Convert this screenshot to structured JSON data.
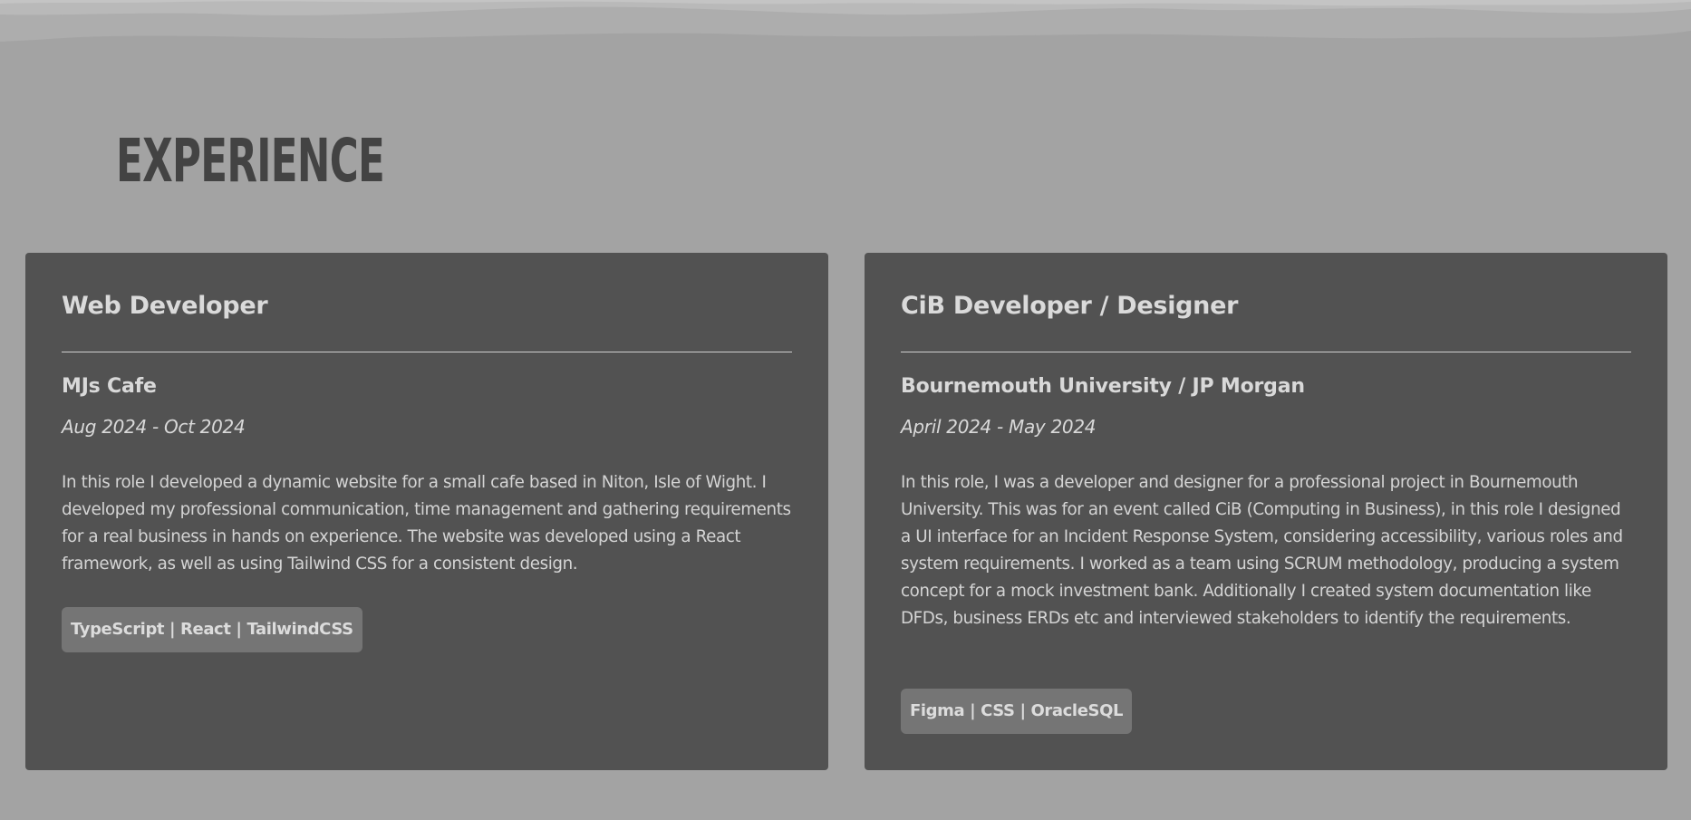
{
  "section": {
    "title": "EXPERIENCE"
  },
  "colors": {
    "background": "#a3a3a3",
    "card": "#525252",
    "heading": "#434343",
    "tag": "#757575"
  },
  "experience": [
    {
      "role": "Web Developer",
      "company": "MJs Cafe",
      "dates": "Aug 2024 - Oct 2024",
      "description": "In this role I developed a dynamic website for a small cafe based in Niton, Isle of Wight. I developed my professional communication, time management and gathering requirements for a real business in hands on experience. The website was developed using a React framework, as well as using Tailwind CSS for a consistent design.",
      "tags": "TypeScript | React | TailwindCSS"
    },
    {
      "role": "CiB Developer / Designer",
      "company": "Bournemouth University / JP Morgan",
      "dates": "April 2024 - May 2024",
      "description": "In this role, I was a developer and designer for a professional project in Bournemouth University. This was for an event called CiB (Computing in Business), in this role I designed a UI interface for an Incident Response System, considering accessibility, various roles and system requirements. I worked as a team using SCRUM methodology, producing a system concept for a mock investment bank. Additionally I created system documentation like DFDs, business ERDs etc and interviewed stakeholders to identify the requirements.",
      "tags": "Figma | CSS | OracleSQL"
    }
  ]
}
